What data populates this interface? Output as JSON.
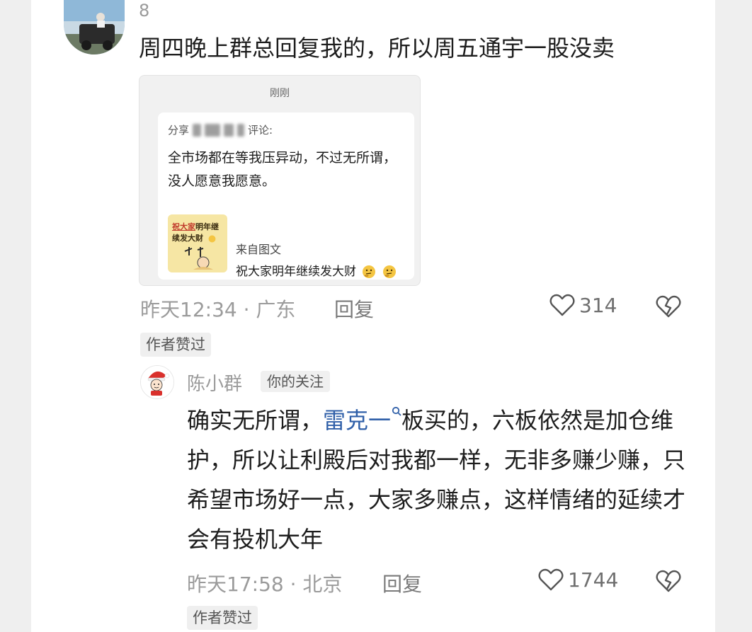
{
  "comment": {
    "username": "8",
    "text": "周四晚上群总回复我的，所以周五通宇一股没卖",
    "screenshot": {
      "time": "刚刚",
      "header_prefix": "分享",
      "header_suffix": "评论:",
      "body": "全市场都在等我压异动，不过无所谓，没人愿意我愿意。",
      "thumb_text_highlight": "祝大家",
      "thumb_text_rest": "明年继续发大财",
      "source_label": "来自图文",
      "source_title": "祝大家明年继续发大财"
    },
    "meta": "昨天12:34 · 广东",
    "reply_label": "回复",
    "likes": "314",
    "author_liked": "作者赞过",
    "icons": [
      "heart-icon",
      "broken-heart-icon"
    ]
  },
  "reply": {
    "username": "陈小群",
    "badge": "你的关注",
    "text_before": "确实无所谓，",
    "link_text": "雷克一",
    "text_after": "板买的，六板依然是加仓维护，所以让利殿后对我都一样，无非多赚少赚，只希望市场好一点，大家多赚点，这样情绪的延续才会有投机大年",
    "meta": "昨天17:58 · 北京",
    "reply_label": "回复",
    "likes": "1744",
    "author_liked": "作者赞过",
    "icons": [
      "search-icon",
      "heart-icon",
      "broken-heart-icon"
    ]
  },
  "colors": {
    "link": "#2f5fa8",
    "muted": "#9b9b9b",
    "chip_bg": "#efefef"
  }
}
